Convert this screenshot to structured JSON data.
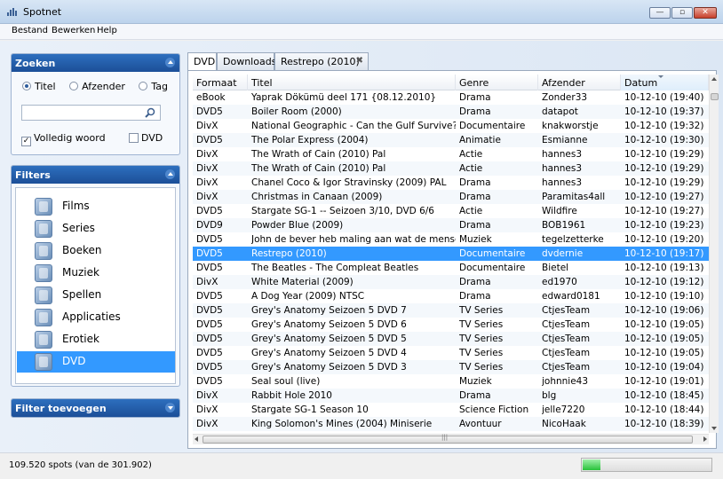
{
  "window": {
    "title": "Spotnet",
    "min_glyph": "—",
    "max_glyph": "▫",
    "close_glyph": "✕"
  },
  "menu": [
    "Bestand",
    "Bewerken",
    "Help"
  ],
  "search": {
    "header": "Zoeken",
    "radios": [
      {
        "label": "Titel",
        "checked": true
      },
      {
        "label": "Afzender",
        "checked": false
      },
      {
        "label": "Tag",
        "checked": false
      }
    ],
    "query": "",
    "checkboxes": [
      {
        "label": "Volledig woord",
        "checked": true,
        "mark": "✓"
      },
      {
        "label": "DVD",
        "checked": false,
        "mark": ""
      }
    ]
  },
  "filters": {
    "header": "Filters",
    "items": [
      {
        "label": "Films",
        "icon": "film-icon"
      },
      {
        "label": "Series",
        "icon": "series-icon"
      },
      {
        "label": "Boeken",
        "icon": "book-icon"
      },
      {
        "label": "Muziek",
        "icon": "music-icon"
      },
      {
        "label": "Spellen",
        "icon": "gamepad-icon"
      },
      {
        "label": "Applicaties",
        "icon": "app-icon"
      },
      {
        "label": "Erotiek",
        "icon": "x-icon"
      },
      {
        "label": "DVD",
        "icon": "dvd-icon",
        "selected": true
      }
    ]
  },
  "filter_add": {
    "header": "Filter toevoegen"
  },
  "tabs": [
    {
      "label": "DVD",
      "active": true
    },
    {
      "label": "Downloads",
      "active": false
    },
    {
      "label": "Restrepo (2010)",
      "active": false,
      "close": "✖"
    }
  ],
  "grid": {
    "columns": [
      "Formaat",
      "Titel",
      "Genre",
      "Afzender",
      "Datum"
    ],
    "rows": [
      [
        "eBook",
        "Yaprak Dökümü deel 171 {08.12.2010}",
        "Drama",
        "Zonder33",
        "10-12-10 (19:40)"
      ],
      [
        "DVD5",
        "Boiler Room (2000)",
        "Drama",
        "datapot",
        "10-12-10 (19:37)"
      ],
      [
        "DivX",
        "National Geographic - Can the Gulf Survive? (20",
        "Documentaire",
        "knakworstje",
        "10-12-10 (19:32)"
      ],
      [
        "DVD5",
        "The Polar Express (2004)",
        "Animatie",
        "Esmianne",
        "10-12-10 (19:30)"
      ],
      [
        "DivX",
        "The Wrath of Cain (2010) Pal",
        "Actie",
        "hannes3",
        "10-12-10 (19:29)"
      ],
      [
        "DivX",
        "The Wrath of Cain (2010) Pal",
        "Actie",
        "hannes3",
        "10-12-10 (19:29)"
      ],
      [
        "DivX",
        "Chanel Coco & Igor Stravinsky (2009) PAL",
        "Drama",
        "hannes3",
        "10-12-10 (19:29)"
      ],
      [
        "DivX",
        "Christmas in Canaan (2009)",
        "Drama",
        "Paramitas4all",
        "10-12-10 (19:27)"
      ],
      [
        "DVD5",
        "Stargate SG-1 -- Seizoen 3/10, DVD 6/6",
        "Actie",
        "Wildfire",
        "10-12-10 (19:27)"
      ],
      [
        "DVD9",
        "Powder Blue (2009)",
        "Drama",
        "BOB1961",
        "10-12-10 (19:23)"
      ],
      [
        "DVD5",
        "John de bever heb maling aan wat de mensen z",
        "Muziek",
        "tegelzetterke",
        "10-12-10 (19:20)"
      ],
      [
        "DVD5",
        "Restrepo (2010)",
        "Documentaire",
        "dvdernie",
        "10-12-10 (19:17)"
      ],
      [
        "DVD5",
        "The Beatles - The Compleat Beatles",
        "Documentaire",
        "Bietel",
        "10-12-10 (19:13)"
      ],
      [
        "DivX",
        "White Material (2009)",
        "Drama",
        "ed1970",
        "10-12-10 (19:12)"
      ],
      [
        "DVD5",
        "A Dog Year (2009) NTSC",
        "Drama",
        "edward0181",
        "10-12-10 (19:10)"
      ],
      [
        "DVD5",
        "Grey's Anatomy Seizoen 5 DVD 7",
        "TV Series",
        "CtjesTeam",
        "10-12-10 (19:06)"
      ],
      [
        "DVD5",
        "Grey's Anatomy Seizoen 5 DVD 6",
        "TV Series",
        "CtjesTeam",
        "10-12-10 (19:05)"
      ],
      [
        "DVD5",
        "Grey's Anatomy Seizoen 5 DVD 5",
        "TV Series",
        "CtjesTeam",
        "10-12-10 (19:05)"
      ],
      [
        "DVD5",
        "Grey's Anatomy Seizoen 5 DVD 4",
        "TV Series",
        "CtjesTeam",
        "10-12-10 (19:05)"
      ],
      [
        "DVD5",
        "Grey's Anatomy Seizoen 5 DVD 3",
        "TV Series",
        "CtjesTeam",
        "10-12-10 (19:04)"
      ],
      [
        "DVD5",
        "Seal soul (live)",
        "Muziek",
        "johnnie43",
        "10-12-10 (19:01)"
      ],
      [
        "DivX",
        "Rabbit Hole 2010",
        "Drama",
        "blg",
        "10-12-10 (18:45)"
      ],
      [
        "DivX",
        "Stargate SG-1 Season 10",
        "Science Fiction",
        "jelle7220",
        "10-12-10 (18:44)"
      ],
      [
        "DivX",
        "King Solomon's Mines (2004) Miniserie",
        "Avontuur",
        "NicoHaak",
        "10-12-10 (18:39)"
      ]
    ],
    "selected_row": 11
  },
  "status": {
    "text": "109.520 spots (van de 301.902)",
    "progress": 0.14
  }
}
